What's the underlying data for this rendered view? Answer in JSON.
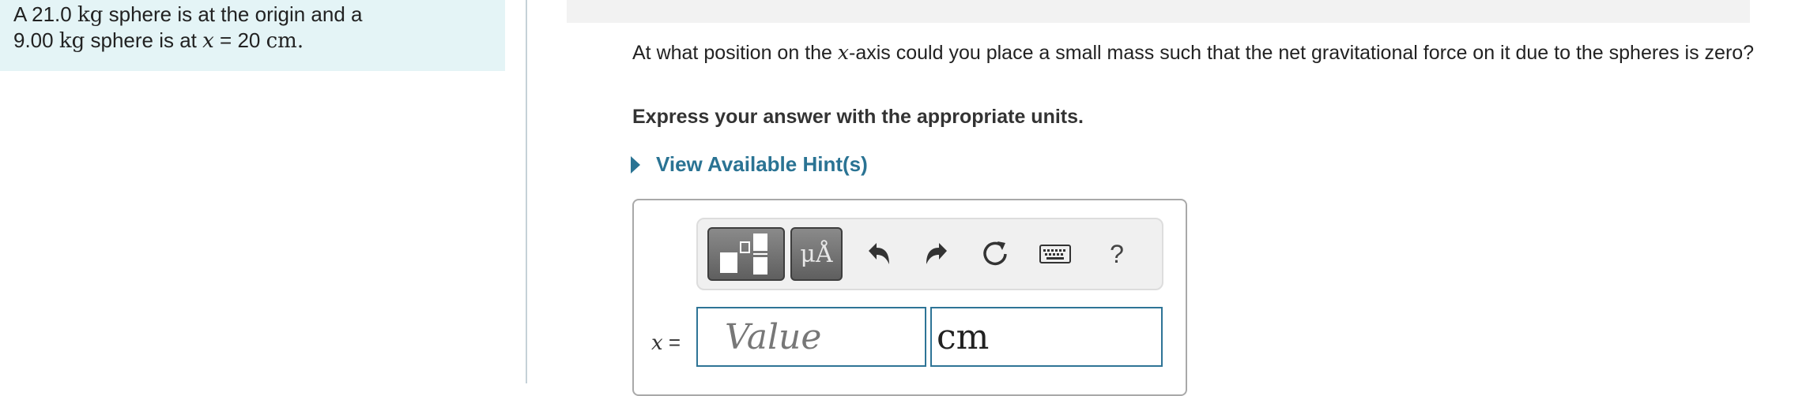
{
  "problem": {
    "line1_pre": "A 21.0",
    "line1_unit": "kg",
    "line1_post": "sphere is at the origin and a",
    "line2_pre": "9.00",
    "line2_unit": "kg",
    "line2_mid": "sphere is at",
    "line2_var": "x",
    "line2_eq": "= 20",
    "line2_unit2": "cm",
    "line2_end": "."
  },
  "question": {
    "text_pre": "At what position on the",
    "axis_var": "x",
    "text_post": "-axis could you place a small mass such that the net gravitational force on it due to the spheres is zero?"
  },
  "instruction": "Express your answer with the appropriate units.",
  "hint": {
    "label": "View Available Hint(s)"
  },
  "toolbar": {
    "templates_icon": "templates-icon",
    "units_label": "μÅ",
    "undo_icon": "undo-icon",
    "redo_icon": "redo-icon",
    "reset_icon": "reset-icon",
    "keyboard_icon": "keyboard-icon",
    "help_label": "?"
  },
  "answer": {
    "variable": "x",
    "equals": "=",
    "value_placeholder": "Value",
    "value": "",
    "units_value": "cm"
  },
  "colors": {
    "panel_bg": "#e4f4f6",
    "accent": "#2a7393",
    "input_border": "#2e7496"
  }
}
